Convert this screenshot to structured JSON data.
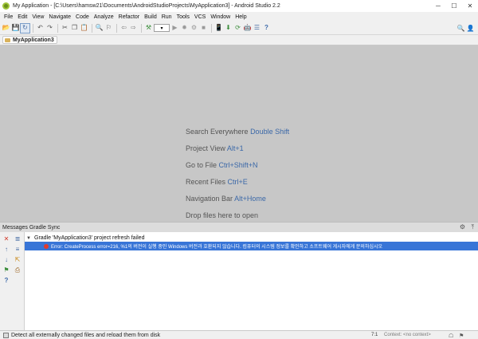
{
  "window": {
    "title": "My Application - [C:\\Users\\hamsw21\\Documents\\AndroidStudioProjects\\MyApplication3] - Android Studio 2.2",
    "minimize_glyph": "─",
    "maximize_glyph": "☐",
    "close_glyph": "✕"
  },
  "menu": {
    "items": [
      "File",
      "Edit",
      "View",
      "Navigate",
      "Code",
      "Analyze",
      "Refactor",
      "Build",
      "Run",
      "Tools",
      "VCS",
      "Window",
      "Help"
    ]
  },
  "toolbar": {
    "buttons": [
      {
        "icon": "open-icon",
        "glyph": "📂"
      },
      {
        "icon": "save-icon",
        "glyph": "💾"
      },
      {
        "icon": "sync-icon",
        "glyph": "↻"
      },
      {
        "icon": "undo-icon",
        "glyph": "↶"
      },
      {
        "icon": "redo-icon",
        "glyph": "↷"
      },
      {
        "icon": "cut-icon",
        "glyph": "✂"
      },
      {
        "icon": "copy-icon",
        "glyph": "❐"
      },
      {
        "icon": "paste-icon",
        "glyph": "📋"
      },
      {
        "icon": "find-icon",
        "glyph": "🔍"
      },
      {
        "icon": "replace-icon",
        "glyph": "⚐"
      },
      {
        "icon": "back-icon",
        "glyph": "⇦"
      },
      {
        "icon": "forward-icon",
        "glyph": "⇨"
      },
      {
        "icon": "make-icon",
        "glyph": "⚒"
      },
      {
        "icon": "run-icon",
        "glyph": "▶"
      },
      {
        "icon": "debug-icon",
        "glyph": "✹"
      },
      {
        "icon": "attach-icon",
        "glyph": "⚙"
      },
      {
        "icon": "stop-icon",
        "glyph": "■"
      },
      {
        "icon": "avd-icon",
        "glyph": "📱"
      },
      {
        "icon": "sdk-icon",
        "glyph": "⬇"
      },
      {
        "icon": "gradle-sync-icon",
        "glyph": "⟳"
      },
      {
        "icon": "monitor-icon",
        "glyph": "🤖"
      },
      {
        "icon": "structure-icon",
        "glyph": "☰"
      },
      {
        "icon": "help-icon",
        "glyph": "?"
      }
    ],
    "search_glyph": "🔍",
    "user_glyph": "👤"
  },
  "breadcrumb": {
    "project": "MyApplication3"
  },
  "editor_hints": [
    {
      "label": "Search Everywhere",
      "shortcut": "Double Shift"
    },
    {
      "label": "Project View",
      "shortcut": "Alt+1"
    },
    {
      "label": "Go to File",
      "shortcut": "Ctrl+Shift+N"
    },
    {
      "label": "Recent Files",
      "shortcut": "Ctrl+E"
    },
    {
      "label": "Navigation Bar",
      "shortcut": "Alt+Home"
    },
    {
      "label": "Drop files here to open",
      "shortcut": ""
    }
  ],
  "messages_panel": {
    "title": "Messages Gradle Sync",
    "gear_glyph": "⚙",
    "hide_glyph": "⤒",
    "parent_row": "Gradle 'MyApplication3' project refresh failed",
    "error_row": "Error: CreateProcess error=216, %1의 버전이 실행 중인 Windows 버전과 호환되지 않습니다. 컴퓨터의 시스템 정보를 확인하고 소프트웨어 게시자에게 문의하십시오",
    "toggle_glyph": "▼",
    "side_buttons": [
      {
        "name": "close-icon",
        "glyph": "✕",
        "color": "#d23a2a"
      },
      {
        "name": "expand-all-icon",
        "glyph": "≣",
        "color": "#4a6fa5"
      },
      {
        "name": "prev-icon",
        "glyph": "↑",
        "color": "#4a6fa5"
      },
      {
        "name": "collapse-all-icon",
        "glyph": "≡",
        "color": "#4a6fa5"
      },
      {
        "name": "next-icon",
        "glyph": "↓",
        "color": "#4a6fa5"
      },
      {
        "name": "export-icon",
        "glyph": "⇱",
        "color": "#c98a1a"
      },
      {
        "name": "filter-icon",
        "glyph": "⚑",
        "color": "#3d8f3d"
      },
      {
        "name": "print-icon",
        "glyph": "⎙",
        "color": "#a06a2a"
      },
      {
        "name": "help-icon",
        "glyph": "?",
        "color": "#3b68a8"
      }
    ]
  },
  "status": {
    "message": "Detect all externally changed files and reload them from disk",
    "position": "7:1",
    "context": "Context: <no context>",
    "right1_glyph": "☖",
    "right2_glyph": "⚑"
  },
  "colors": {
    "editor_bg": "#c7c7c7",
    "shortcut_blue": "#3b68a8",
    "selection_blue": "#3875d7",
    "error_red": "#e23b2e"
  }
}
